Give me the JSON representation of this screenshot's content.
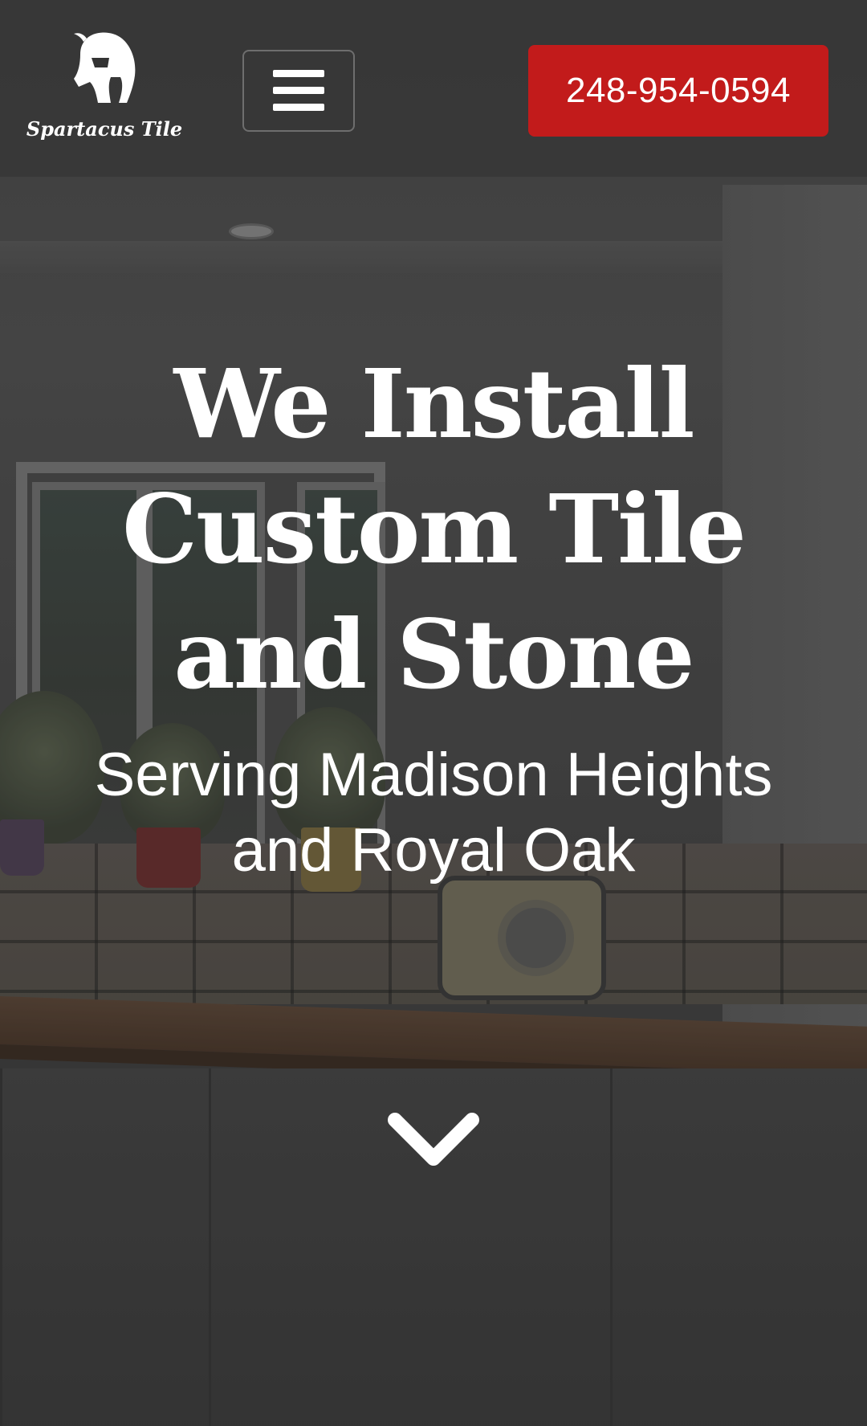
{
  "header": {
    "logo_text": "Spartacus Tile",
    "logo_icon": "spartan-helmet-icon",
    "menu_icon": "hamburger-menu-icon",
    "phone_label": "248-954-0594"
  },
  "hero": {
    "headline_lines": [
      "We Install",
      "Custom Tile",
      "and Stone"
    ],
    "subhead_lines": [
      "Serving Madison Heights",
      "and Royal Oak"
    ],
    "scroll_icon": "chevron-down-icon"
  },
  "colors": {
    "phone_button_bg": "#c21b1b",
    "text": "#ffffff"
  }
}
